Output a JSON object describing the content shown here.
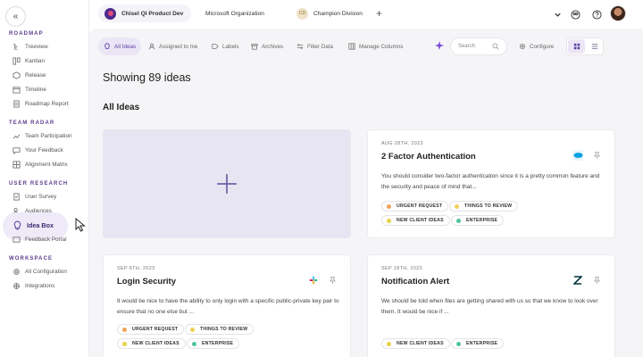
{
  "sidebar": {
    "sections": [
      {
        "title": "ROADMAP",
        "items": [
          {
            "label": "Treeview",
            "icon": "treeview-icon"
          },
          {
            "label": "Kanban",
            "icon": "kanban-icon"
          },
          {
            "label": "Release",
            "icon": "release-icon"
          },
          {
            "label": "Timeline",
            "icon": "timeline-icon"
          },
          {
            "label": "Roadmap Report",
            "icon": "report-icon"
          }
        ]
      },
      {
        "title": "TEAM RADAR",
        "items": [
          {
            "label": "Team Participation",
            "icon": "participation-icon"
          },
          {
            "label": "Your Feedback",
            "icon": "feedback-icon"
          },
          {
            "label": "Alignment Matrix",
            "icon": "matrix-icon"
          }
        ]
      },
      {
        "title": "USER RESEARCH",
        "items": [
          {
            "label": "User Survey",
            "icon": "survey-icon"
          },
          {
            "label": "Audiences",
            "icon": "audiences-icon"
          },
          {
            "label": "Idea Box",
            "icon": "lightbulb-icon",
            "active": true
          },
          {
            "label": "Feedback Portal",
            "icon": "portal-icon"
          }
        ]
      },
      {
        "title": "WORKSPACE",
        "items": [
          {
            "label": "All Configuration",
            "icon": "settings-icon"
          },
          {
            "label": "Integrations",
            "icon": "integrations-icon"
          }
        ]
      }
    ]
  },
  "topbar": {
    "tabs": [
      {
        "label": "Chisel QI Product Dev",
        "badge_color": "#4b2a8c"
      },
      {
        "label": "Microsoft Organization"
      },
      {
        "label": "Champion Division",
        "badge_text": "CD",
        "badge_color": "#efe3c8"
      }
    ],
    "add_tab": "+"
  },
  "filters": {
    "all_ideas": "All Ideas",
    "assigned": "Assigned to me",
    "labels": "Labels",
    "archives": "Archives",
    "filter_data": "Filter Data",
    "manage_columns": "Manage Columns",
    "search_placeholder": "Search",
    "configure": "Configure"
  },
  "main": {
    "showing": "Showing 89 ideas",
    "section_title": "All Ideas"
  },
  "cards": [
    {
      "date": "AUG 28TH, 2023",
      "title": "2 Factor Authentication",
      "description": "You should consider two-factor authentication since it is a pretty common feature and the security and peace of mind that...",
      "source": "salesforce",
      "tags": [
        "URGENT REQUEST",
        "THINGS TO REVIEW",
        "NEW CLIENT IDEAS",
        "ENTERPRISE"
      ]
    },
    {
      "date": "SEP 6TH, 2023",
      "title": "Login Security",
      "description": "It would be nice to have the ability to only login with a specific public-private key pair to ensure that no one else but ...",
      "source": "slack",
      "tags": [
        "URGENT REQUEST",
        "THINGS TO REVIEW",
        "NEW CLIENT IDEAS",
        "ENTERPRISE"
      ]
    },
    {
      "date": "SEP 18TH, 2023",
      "title": "Notification Alert",
      "description": "We should be told when files are getting shared with us so that we know to look over them. It would be nice if ...",
      "source": "zendesk",
      "tags": [
        "NEW CLIENT IDEAS",
        "ENTERPRISE"
      ]
    }
  ],
  "tag_colors": {
    "URGENT REQUEST": "#f0a35a",
    "THINGS TO REVIEW": "#f3cf5a",
    "NEW CLIENT IDEAS": "#e5d24a",
    "ENTERPRISE": "#4fc3a1"
  },
  "colors": {
    "accent": "#5a3f9f",
    "active_bg": "#efeaf8",
    "add_card_bg": "#e8e5f3"
  }
}
